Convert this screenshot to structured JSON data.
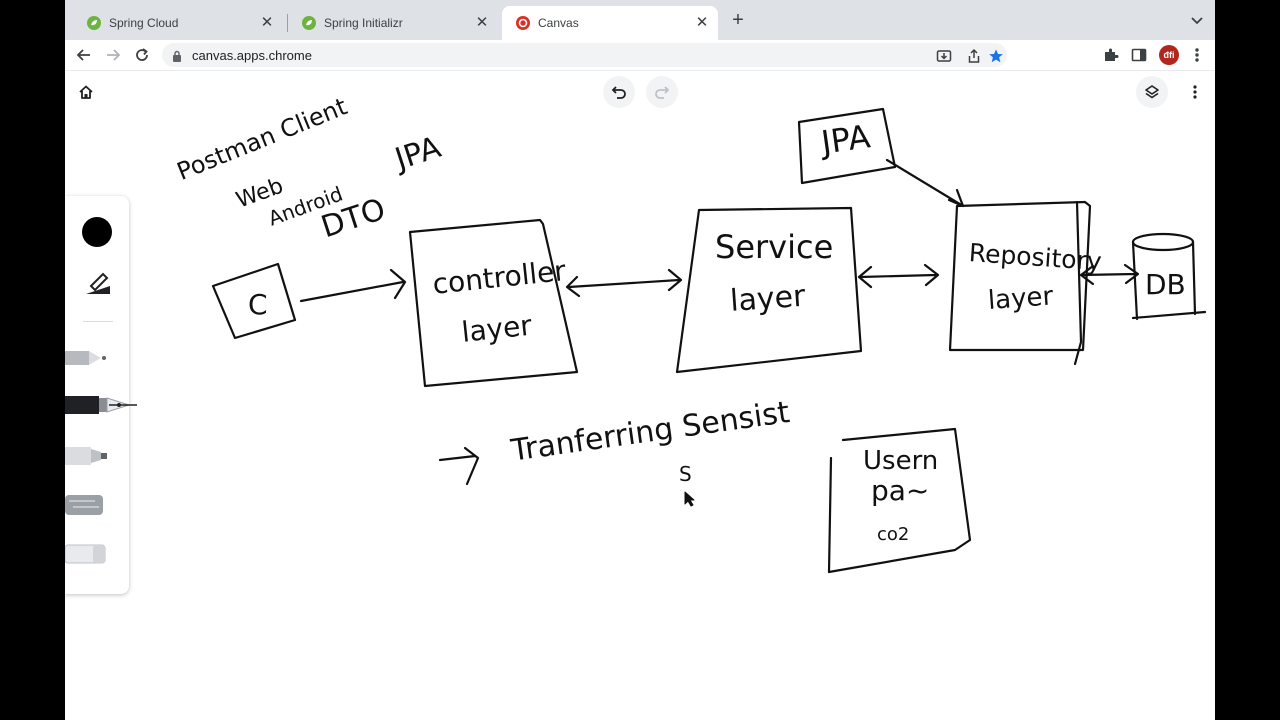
{
  "browser": {
    "tabs": [
      {
        "title": "Spring Cloud",
        "active": false
      },
      {
        "title": "Spring Initializr",
        "active": false
      },
      {
        "title": "Canvas",
        "active": true
      }
    ],
    "url": "canvas.apps.chrome",
    "profile_initials": "đfi"
  },
  "colors": {
    "spring_green": "#6db33f",
    "canvas_red": "#d93025",
    "bookmark_star": "#1a73e8",
    "ink": "#111111"
  },
  "canvas_app": {
    "selected_color": "#000000",
    "tools": [
      "pencil-icon",
      "pen-icon",
      "fountain-pen-icon",
      "marker-icon",
      "chalk-icon",
      "eraser-icon"
    ]
  },
  "drawing": {
    "notes_top": [
      "Postman Client",
      "Web",
      "Android",
      "DTO",
      "JPA"
    ],
    "client_box": "C",
    "controller_box": [
      "controller",
      "layer"
    ],
    "service_box": [
      "Service",
      "layer"
    ],
    "repository_box": [
      "Repository",
      "layer"
    ],
    "jpa_box": "JPA",
    "db_label": "DB",
    "bottom_note": "Tranferring Sensist",
    "bottom_mark": "S",
    "user_box": [
      "Usern",
      "pa~",
      "co2"
    ]
  }
}
